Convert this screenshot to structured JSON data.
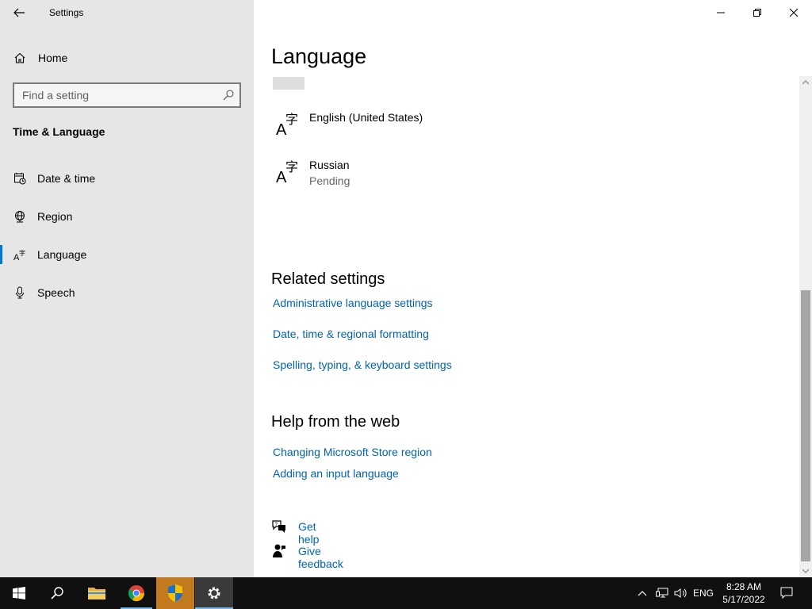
{
  "window": {
    "title": "Settings"
  },
  "sidebar": {
    "home_label": "Home",
    "search_placeholder": "Find a setting",
    "section_title": "Time & Language",
    "items": [
      {
        "label": "Date & time",
        "icon": "calendar-clock-icon"
      },
      {
        "label": "Region",
        "icon": "globe-icon"
      },
      {
        "label": "Language",
        "icon": "language-icon",
        "selected": true
      },
      {
        "label": "Speech",
        "icon": "microphone-icon"
      }
    ]
  },
  "main": {
    "page_title": "Language",
    "languages": [
      {
        "name": "English (United States)",
        "status": ""
      },
      {
        "name": "Russian",
        "status": "Pending"
      }
    ],
    "related_title": "Related settings",
    "related_links": [
      "Administrative language settings",
      "Date, time & regional formatting",
      "Spelling, typing, & keyboard settings"
    ],
    "help_title": "Help from the web",
    "help_links": [
      "Changing Microsoft Store region",
      "Adding an input language"
    ],
    "get_help": "Get help",
    "give_feedback": "Give feedback"
  },
  "taskbar": {
    "apps": [
      "start",
      "search",
      "file-explorer",
      "chrome",
      "security-shield",
      "settings"
    ],
    "lang": "ENG",
    "time": "8:28 AM",
    "date": "5/17/2022"
  },
  "colors": {
    "accent": "#0078d7",
    "link": "#0063b1",
    "sidebar_bg": "#e6e6e6",
    "taskbar_bg": "#101010"
  }
}
